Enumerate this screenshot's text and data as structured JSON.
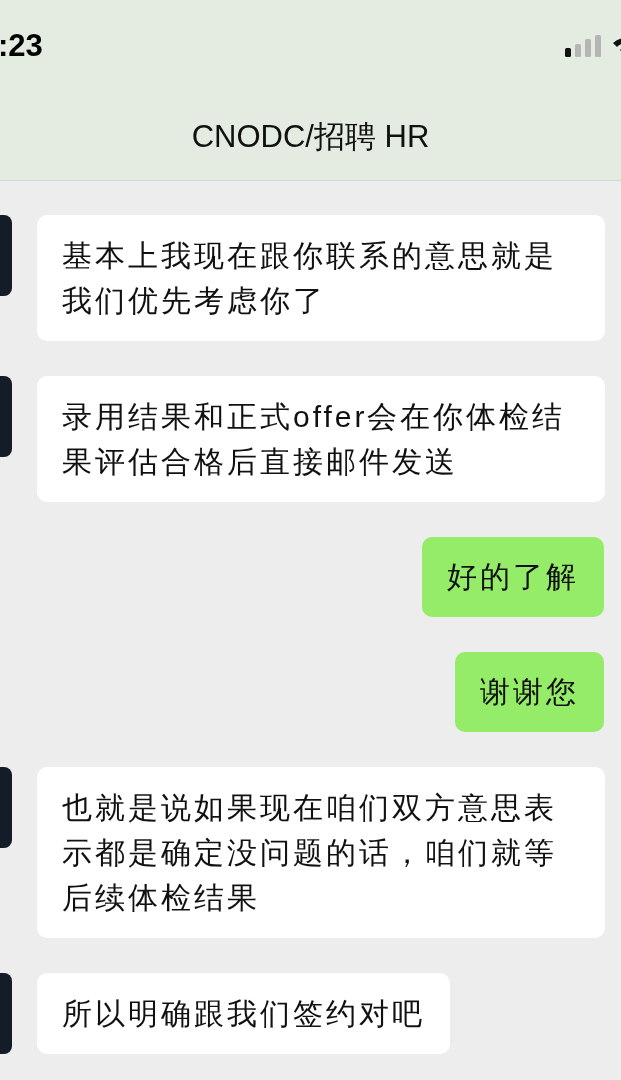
{
  "status_bar": {
    "time": ":23"
  },
  "header": {
    "title": "CNODC/招聘 HR"
  },
  "messages": [
    {
      "kind": "received",
      "text": "基本上我现在跟你联系的意思就是我们优先考虑你了"
    },
    {
      "kind": "received",
      "text": "录用结果和正式offer会在你体检结果评估合格后直接邮件发送"
    },
    {
      "kind": "sent",
      "text": "好的了解"
    },
    {
      "kind": "sent",
      "text": "谢谢您"
    },
    {
      "kind": "received",
      "text": "也就是说如果现在咱们双方意思表示都是确定没问题的话，咱们就等后续体检结果"
    },
    {
      "kind": "received",
      "text": "所以明确跟我们签约对吧"
    }
  ]
}
